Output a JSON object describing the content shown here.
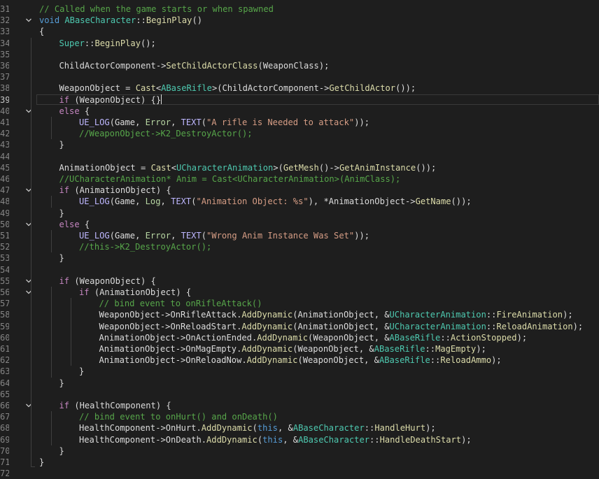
{
  "editor": {
    "first_line_number": 31,
    "active_line_number": 39,
    "folded_lines": [
      32,
      40,
      47,
      50,
      55,
      56,
      66
    ],
    "colors": {
      "background": "#1e1e1e",
      "comment": "#57a64a",
      "keyword": "#569cd6",
      "control_keyword": "#c586c0",
      "type": "#4ec9b0",
      "function": "#dcdcaa",
      "string": "#d69d85",
      "macro": "#beb7ff",
      "enum": "#b8d7a3",
      "plain": "#dcdcdc"
    }
  },
  "lines": [
    {
      "n": "31",
      "indent": 0,
      "tokens": [
        [
          "c",
          "// Called when the game starts or when spawned"
        ]
      ]
    },
    {
      "n": "32",
      "indent": 0,
      "tokens": [
        [
          "k",
          "void"
        ],
        [
          "p",
          " "
        ],
        [
          "t",
          "ABaseCharacter"
        ],
        [
          "p",
          "::"
        ],
        [
          "f",
          "BeginPlay"
        ],
        [
          "p",
          "()"
        ]
      ]
    },
    {
      "n": "33",
      "indent": 0,
      "tokens": [
        [
          "p",
          "{"
        ]
      ]
    },
    {
      "n": "34",
      "indent": 1,
      "tokens": [
        [
          "t",
          "Super"
        ],
        [
          "p",
          "::"
        ],
        [
          "f",
          "BeginPlay"
        ],
        [
          "p",
          "();"
        ]
      ]
    },
    {
      "n": "35",
      "indent": 1,
      "tokens": []
    },
    {
      "n": "36",
      "indent": 1,
      "tokens": [
        [
          "m",
          "ChildActorComponent"
        ],
        [
          "p",
          "->"
        ],
        [
          "f",
          "SetChildActorClass"
        ],
        [
          "p",
          "("
        ],
        [
          "m",
          "WeaponClass"
        ],
        [
          "p",
          ");"
        ]
      ]
    },
    {
      "n": "37",
      "indent": 1,
      "tokens": []
    },
    {
      "n": "38",
      "indent": 1,
      "tokens": [
        [
          "m",
          "WeaponObject"
        ],
        [
          "p",
          " = "
        ],
        [
          "f",
          "Cast"
        ],
        [
          "p",
          "<"
        ],
        [
          "t",
          "ABaseRifle"
        ],
        [
          "p",
          ">("
        ],
        [
          "m",
          "ChildActorComponent"
        ],
        [
          "p",
          "->"
        ],
        [
          "f",
          "GetChildActor"
        ],
        [
          "p",
          "());"
        ]
      ]
    },
    {
      "n": "39",
      "indent": 1,
      "tokens": [
        [
          "kc",
          "if"
        ],
        [
          "p",
          " ("
        ],
        [
          "m",
          "WeaponObject"
        ],
        [
          "p",
          ") {}"
        ]
      ]
    },
    {
      "n": "40",
      "indent": 1,
      "tokens": [
        [
          "kc",
          "else"
        ],
        [
          "p",
          " {"
        ]
      ]
    },
    {
      "n": "41",
      "indent": 2,
      "tokens": [
        [
          "mac",
          "UE_LOG"
        ],
        [
          "p",
          "("
        ],
        [
          "m",
          "Game"
        ],
        [
          "p",
          ", "
        ],
        [
          "e",
          "Error"
        ],
        [
          "p",
          ", "
        ],
        [
          "mac",
          "TEXT"
        ],
        [
          "p",
          "("
        ],
        [
          "s",
          "\"A rifle is Needed to attack\""
        ],
        [
          "p",
          "));"
        ]
      ]
    },
    {
      "n": "42",
      "indent": 2,
      "tokens": [
        [
          "c",
          "//WeaponObject->K2_DestroyActor();"
        ]
      ]
    },
    {
      "n": "43",
      "indent": 1,
      "tokens": [
        [
          "p",
          "}"
        ]
      ]
    },
    {
      "n": "44",
      "indent": 1,
      "tokens": []
    },
    {
      "n": "45",
      "indent": 1,
      "tokens": [
        [
          "m",
          "AnimationObject"
        ],
        [
          "p",
          " = "
        ],
        [
          "f",
          "Cast"
        ],
        [
          "p",
          "<"
        ],
        [
          "t",
          "UCharacterAnimation"
        ],
        [
          "p",
          ">("
        ],
        [
          "f",
          "GetMesh"
        ],
        [
          "p",
          "()->"
        ],
        [
          "f",
          "GetAnimInstance"
        ],
        [
          "p",
          "());"
        ]
      ]
    },
    {
      "n": "46",
      "indent": 1,
      "tokens": [
        [
          "c",
          "//UCharacterAnimation* Anim = Cast<UCharacterAnimation>(AnimClass);"
        ]
      ]
    },
    {
      "n": "47",
      "indent": 1,
      "tokens": [
        [
          "kc",
          "if"
        ],
        [
          "p",
          " ("
        ],
        [
          "m",
          "AnimationObject"
        ],
        [
          "p",
          ") {"
        ]
      ]
    },
    {
      "n": "48",
      "indent": 2,
      "tokens": [
        [
          "mac",
          "UE_LOG"
        ],
        [
          "p",
          "("
        ],
        [
          "m",
          "Game"
        ],
        [
          "p",
          ", "
        ],
        [
          "e",
          "Log"
        ],
        [
          "p",
          ", "
        ],
        [
          "mac",
          "TEXT"
        ],
        [
          "p",
          "("
        ],
        [
          "s",
          "\"Animation Object: %s\""
        ],
        [
          "p",
          "), *"
        ],
        [
          "m",
          "AnimationObject"
        ],
        [
          "p",
          "->"
        ],
        [
          "f",
          "GetName"
        ],
        [
          "p",
          "());"
        ]
      ]
    },
    {
      "n": "49",
      "indent": 1,
      "tokens": [
        [
          "p",
          "}"
        ]
      ]
    },
    {
      "n": "50",
      "indent": 1,
      "tokens": [
        [
          "kc",
          "else"
        ],
        [
          "p",
          " {"
        ]
      ]
    },
    {
      "n": "51",
      "indent": 2,
      "tokens": [
        [
          "mac",
          "UE_LOG"
        ],
        [
          "p",
          "("
        ],
        [
          "m",
          "Game"
        ],
        [
          "p",
          ", "
        ],
        [
          "e",
          "Error"
        ],
        [
          "p",
          ", "
        ],
        [
          "mac",
          "TEXT"
        ],
        [
          "p",
          "("
        ],
        [
          "s",
          "\"Wrong Anim Instance Was Set\""
        ],
        [
          "p",
          "));"
        ]
      ]
    },
    {
      "n": "52",
      "indent": 2,
      "tokens": [
        [
          "c",
          "//this->K2_DestroyActor();"
        ]
      ]
    },
    {
      "n": "53",
      "indent": 1,
      "tokens": [
        [
          "p",
          "}"
        ]
      ]
    },
    {
      "n": "54",
      "indent": 1,
      "tokens": []
    },
    {
      "n": "55",
      "indent": 1,
      "tokens": [
        [
          "kc",
          "if"
        ],
        [
          "p",
          " ("
        ],
        [
          "m",
          "WeaponObject"
        ],
        [
          "p",
          ") {"
        ]
      ]
    },
    {
      "n": "56",
      "indent": 2,
      "tokens": [
        [
          "kc",
          "if"
        ],
        [
          "p",
          " ("
        ],
        [
          "m",
          "AnimationObject"
        ],
        [
          "p",
          ") {"
        ]
      ]
    },
    {
      "n": "57",
      "indent": 3,
      "tokens": [
        [
          "c",
          "// bind event to onRifleAttack()"
        ]
      ]
    },
    {
      "n": "58",
      "indent": 3,
      "tokens": [
        [
          "m",
          "WeaponObject"
        ],
        [
          "p",
          "->"
        ],
        [
          "m",
          "OnRifleAttack"
        ],
        [
          "p",
          "."
        ],
        [
          "f",
          "AddDynamic"
        ],
        [
          "p",
          "("
        ],
        [
          "m",
          "AnimationObject"
        ],
        [
          "p",
          ", &"
        ],
        [
          "t",
          "UCharacterAnimation"
        ],
        [
          "p",
          "::"
        ],
        [
          "f",
          "FireAnimation"
        ],
        [
          "p",
          ");"
        ]
      ]
    },
    {
      "n": "59",
      "indent": 3,
      "tokens": [
        [
          "m",
          "WeaponObject"
        ],
        [
          "p",
          "->"
        ],
        [
          "m",
          "OnReloadStart"
        ],
        [
          "p",
          "."
        ],
        [
          "f",
          "AddDynamic"
        ],
        [
          "p",
          "("
        ],
        [
          "m",
          "AnimationObject"
        ],
        [
          "p",
          ", &"
        ],
        [
          "t",
          "UCharacterAnimation"
        ],
        [
          "p",
          "::"
        ],
        [
          "f",
          "ReloadAnimation"
        ],
        [
          "p",
          ");"
        ]
      ]
    },
    {
      "n": "60",
      "indent": 3,
      "tokens": [
        [
          "m",
          "AnimationObject"
        ],
        [
          "p",
          "->"
        ],
        [
          "m",
          "OnActionEnded"
        ],
        [
          "p",
          "."
        ],
        [
          "f",
          "AddDynamic"
        ],
        [
          "p",
          "("
        ],
        [
          "m",
          "WeaponObject"
        ],
        [
          "p",
          ", &"
        ],
        [
          "t",
          "ABaseRifle"
        ],
        [
          "p",
          "::"
        ],
        [
          "f",
          "ActionStopped"
        ],
        [
          "p",
          ");"
        ]
      ]
    },
    {
      "n": "61",
      "indent": 3,
      "tokens": [
        [
          "m",
          "AnimationObject"
        ],
        [
          "p",
          "->"
        ],
        [
          "m",
          "OnMagEmpty"
        ],
        [
          "p",
          "."
        ],
        [
          "f",
          "AddDynamic"
        ],
        [
          "p",
          "("
        ],
        [
          "m",
          "WeaponObject"
        ],
        [
          "p",
          ", &"
        ],
        [
          "t",
          "ABaseRifle"
        ],
        [
          "p",
          "::"
        ],
        [
          "f",
          "MagEmpty"
        ],
        [
          "p",
          ");"
        ]
      ]
    },
    {
      "n": "62",
      "indent": 3,
      "tokens": [
        [
          "m",
          "AnimationObject"
        ],
        [
          "p",
          "->"
        ],
        [
          "m",
          "OnReloadNow"
        ],
        [
          "p",
          "."
        ],
        [
          "f",
          "AddDynamic"
        ],
        [
          "p",
          "("
        ],
        [
          "m",
          "WeaponObject"
        ],
        [
          "p",
          ", &"
        ],
        [
          "t",
          "ABaseRifle"
        ],
        [
          "p",
          "::"
        ],
        [
          "f",
          "ReloadAmmo"
        ],
        [
          "p",
          ");"
        ]
      ]
    },
    {
      "n": "63",
      "indent": 2,
      "tokens": [
        [
          "p",
          "}"
        ]
      ]
    },
    {
      "n": "64",
      "indent": 1,
      "tokens": [
        [
          "p",
          "}"
        ]
      ]
    },
    {
      "n": "65",
      "indent": 1,
      "tokens": []
    },
    {
      "n": "66",
      "indent": 1,
      "tokens": [
        [
          "kc",
          "if"
        ],
        [
          "p",
          " ("
        ],
        [
          "m",
          "HealthComponent"
        ],
        [
          "p",
          ") {"
        ]
      ]
    },
    {
      "n": "67",
      "indent": 2,
      "tokens": [
        [
          "c",
          "// bind event to onHurt() and onDeath()"
        ]
      ]
    },
    {
      "n": "68",
      "indent": 2,
      "tokens": [
        [
          "m",
          "HealthComponent"
        ],
        [
          "p",
          "->"
        ],
        [
          "m",
          "OnHurt"
        ],
        [
          "p",
          "."
        ],
        [
          "f",
          "AddDynamic"
        ],
        [
          "p",
          "("
        ],
        [
          "k",
          "this"
        ],
        [
          "p",
          ", &"
        ],
        [
          "t",
          "ABaseCharacter"
        ],
        [
          "p",
          "::"
        ],
        [
          "f",
          "HandleHurt"
        ],
        [
          "p",
          ");"
        ]
      ]
    },
    {
      "n": "69",
      "indent": 2,
      "tokens": [
        [
          "m",
          "HealthComponent"
        ],
        [
          "p",
          "->"
        ],
        [
          "m",
          "OnDeath"
        ],
        [
          "p",
          "."
        ],
        [
          "f",
          "AddDynamic"
        ],
        [
          "p",
          "("
        ],
        [
          "k",
          "this"
        ],
        [
          "p",
          ", &"
        ],
        [
          "t",
          "ABaseCharacter"
        ],
        [
          "p",
          "::"
        ],
        [
          "f",
          "HandleDeathStart"
        ],
        [
          "p",
          ");"
        ]
      ]
    },
    {
      "n": "70",
      "indent": 1,
      "tokens": [
        [
          "p",
          "}"
        ]
      ]
    },
    {
      "n": "71",
      "indent": 0,
      "tokens": [
        [
          "p",
          "}"
        ]
      ]
    },
    {
      "n": "72",
      "indent": 0,
      "tokens": []
    }
  ]
}
